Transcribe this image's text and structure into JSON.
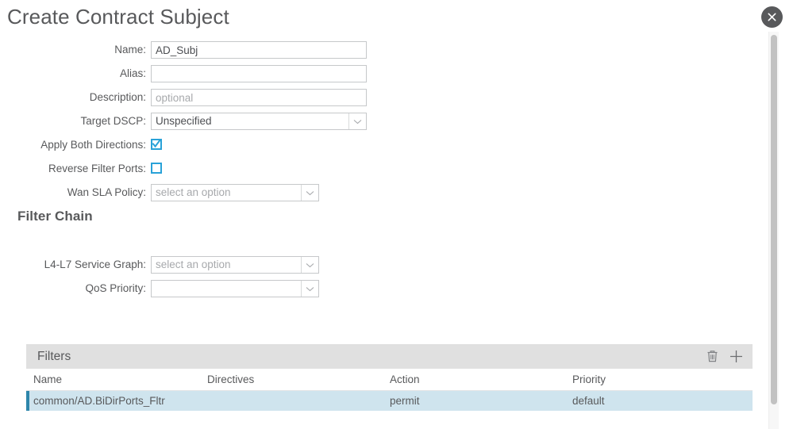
{
  "dialog": {
    "title": "Create Contract Subject",
    "close_icon": "close-icon"
  },
  "form": {
    "fields": [
      {
        "label": "Name:",
        "type": "text",
        "value": "AD_Subj",
        "placeholder": ""
      },
      {
        "label": "Alias:",
        "type": "text",
        "value": "",
        "placeholder": ""
      },
      {
        "label": "Description:",
        "type": "text",
        "value": "",
        "placeholder": "optional"
      },
      {
        "label": "Target DSCP:",
        "type": "select",
        "value": "Unspecified",
        "is_placeholder": false
      },
      {
        "label": "Apply Both Directions:",
        "type": "checkbox",
        "checked": true
      },
      {
        "label": "Reverse Filter Ports:",
        "type": "checkbox",
        "checked": false
      },
      {
        "label": "Wan SLA Policy:",
        "type": "select",
        "value": "select an option",
        "is_placeholder": true
      }
    ]
  },
  "filter_chain": {
    "heading": "Filter Chain",
    "fields": [
      {
        "label": "L4-L7 Service Graph:",
        "type": "select",
        "value": "select an option",
        "is_placeholder": true
      },
      {
        "label": "QoS Priority:",
        "type": "select",
        "value": "",
        "is_placeholder": true
      }
    ]
  },
  "filters_panel": {
    "title": "Filters",
    "delete_icon": "trash-icon",
    "add_icon": "plus-icon",
    "columns": [
      "Name",
      "Directives",
      "Action",
      "Priority"
    ],
    "rows": [
      {
        "name": "common/AD.BiDirPorts_Fltr",
        "directives": "",
        "action": "permit",
        "priority": "default",
        "selected": true
      }
    ]
  },
  "colors": {
    "accent_blue": "#29a2d8",
    "row_selected_bg": "#cfe4ee",
    "row_accent_bar": "#2e86ab",
    "panel_header_bg": "#e0e0e0",
    "text_gray": "#58595b",
    "close_btn_bg": "#58595b"
  },
  "scrollbar": {
    "orientation": "vertical"
  }
}
